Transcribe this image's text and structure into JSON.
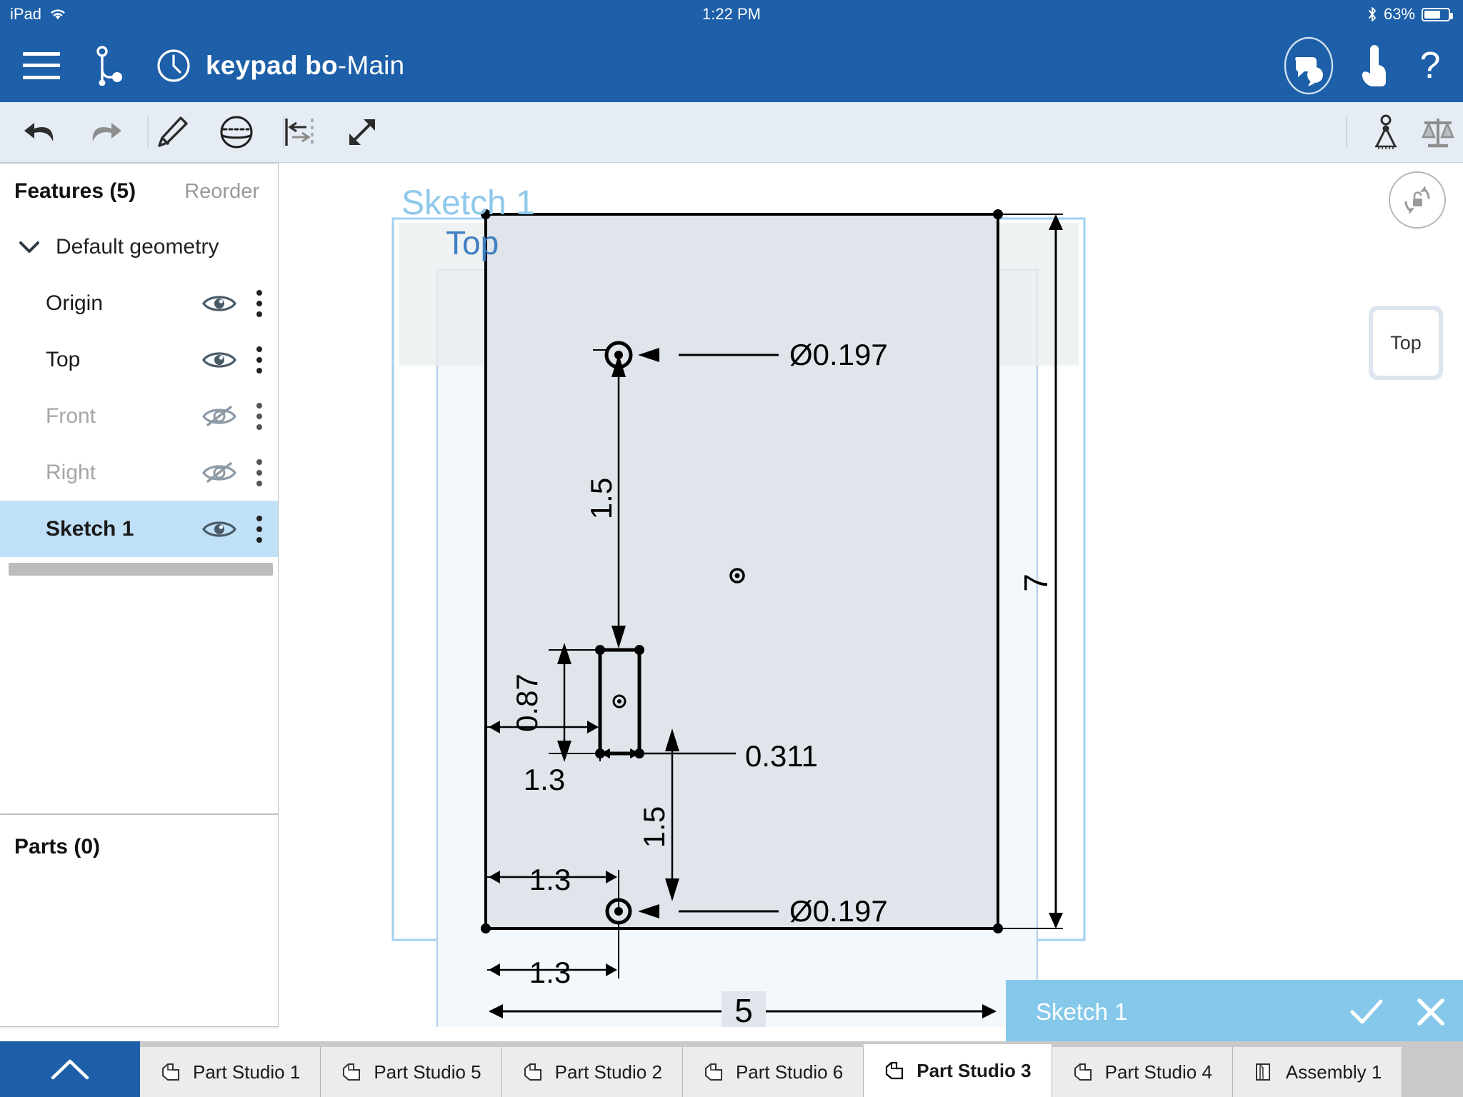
{
  "status_bar": {
    "device": "iPad",
    "wifi_icon": "wifi-icon",
    "time": "1:22 PM",
    "bluetooth_icon": "bluetooth-icon",
    "battery_percent": "63%",
    "battery_level": 63
  },
  "app_header": {
    "menu_icon": "hamburger-menu-icon",
    "branch_icon": "version-branch-icon",
    "history_icon": "history-clock-icon",
    "document_name": "keypad bo",
    "separator": " - ",
    "workspace": "Main",
    "comments_icon": "comments-icon",
    "follow_icon": "follow-pointer-icon",
    "help_icon": "help-question-icon",
    "background": "#1d5fa8"
  },
  "toolbar": {
    "undo": "undo-icon",
    "redo": "redo-icon",
    "sketch": "sketch-pencil-icon",
    "shape": "sphere-primitive-icon",
    "dimension": "dimension-icon",
    "transform": "resize-arrows-icon",
    "measure": "measure-compass-icon",
    "mass": "mass-properties-scale-icon",
    "background": "#e6ecf3"
  },
  "features_panel": {
    "title": "Features (5)",
    "reorder_label": "Reorder",
    "group": {
      "label": "Default geometry",
      "expanded": true,
      "chevron": "chevron-down-icon"
    },
    "items": [
      {
        "label": "Origin",
        "visible": true,
        "selected": false,
        "eye_icon": "eye-visible-icon"
      },
      {
        "label": "Top",
        "visible": true,
        "selected": false,
        "eye_icon": "eye-visible-icon"
      },
      {
        "label": "Front",
        "visible": false,
        "selected": false,
        "eye_icon": "eye-hidden-icon"
      },
      {
        "label": "Right",
        "visible": false,
        "selected": false,
        "eye_icon": "eye-hidden-icon"
      },
      {
        "label": "Sketch 1",
        "visible": true,
        "selected": true,
        "eye_icon": "eye-visible-icon"
      }
    ],
    "selection_color": "#bfe0f7"
  },
  "parts_panel": {
    "title": "Parts (0)"
  },
  "panel_collapse": {
    "icon": "chevron-left-icon"
  },
  "viewport": {
    "sketch_label": "Sketch 1",
    "plane_label": "Top",
    "rotate_lock_icon": "rotate-lock-icon",
    "view_cube_label": "Top",
    "sketch_label_color": "#8ec8ea",
    "plane_label_color": "#3f7fc0"
  },
  "sketch_dialog": {
    "title": "Sketch 1",
    "accept_icon": "checkmark-icon",
    "cancel_icon": "close-x-icon",
    "background": "#85c8ea"
  },
  "tabbar": {
    "expand_icon": "chevron-up-icon",
    "tabs": [
      {
        "label": "Part Studio 1",
        "icon": "part-studio-icon",
        "active": false
      },
      {
        "label": "Part Studio 5",
        "icon": "part-studio-icon",
        "active": false
      },
      {
        "label": "Part Studio 2",
        "icon": "part-studio-icon",
        "active": false
      },
      {
        "label": "Part Studio 6",
        "icon": "part-studio-icon",
        "active": false
      },
      {
        "label": "Part Studio 3",
        "icon": "part-studio-icon",
        "active": true
      },
      {
        "label": "Part Studio 4",
        "icon": "part-studio-icon",
        "active": false
      },
      {
        "label": "Assembly 1",
        "icon": "assembly-icon",
        "active": false
      }
    ]
  },
  "sketch_dimensions": {
    "outer_width": "5",
    "outer_height": "7",
    "top_hole_diameter": "Ø0.197",
    "bottom_hole_diameter": "Ø0.197",
    "top_hole_vertical": "1.5",
    "bottom_hole_vertical": "1.5",
    "slot_height": "0.87",
    "slot_width": "0.311",
    "slot_x_offset": "1.3",
    "hole_x_offset_upper": "1.3",
    "hole_x_offset_lower": "1.3"
  }
}
